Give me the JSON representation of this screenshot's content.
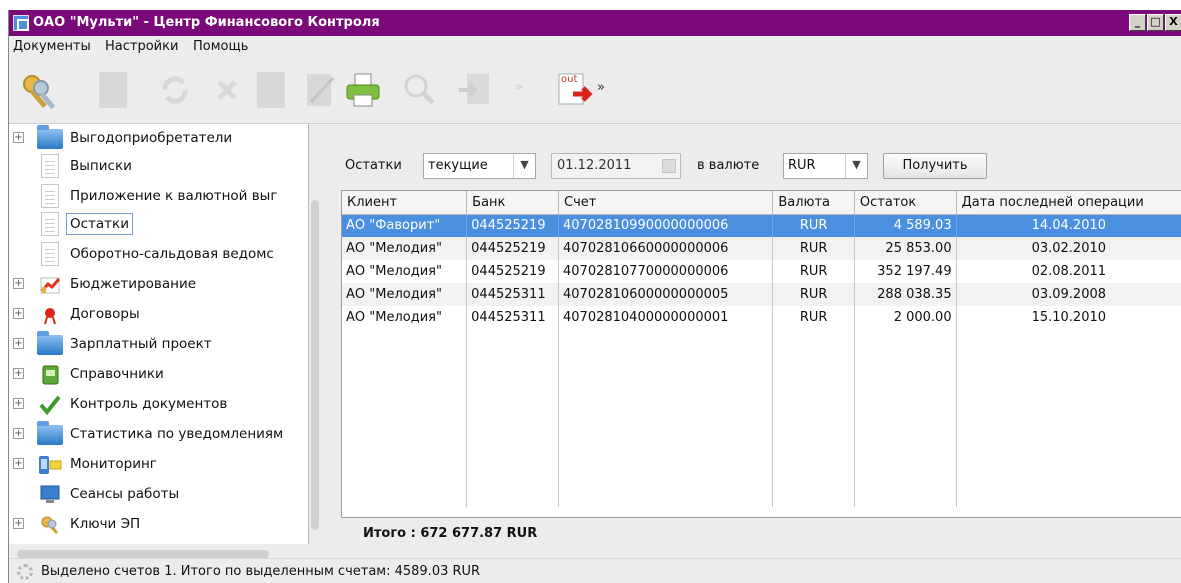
{
  "window": {
    "title": "ОАО \"Мульти\" - Центр Финансового Контроля",
    "controls": {
      "minimize": "_",
      "maximize": "□",
      "close": "X"
    }
  },
  "menu": [
    "Документы",
    "Настройки",
    "Помощь"
  ],
  "toolbar": {
    "icons": [
      "keys-icon",
      "document-icon",
      "refresh-icon",
      "delete-icon",
      "save-icon",
      "edit-icon",
      "print-icon",
      "search-icon",
      "import-icon",
      "more-chevron-icon",
      "export-out-icon",
      "more-chevron-icon"
    ],
    "export_label": "out"
  },
  "sidebar": {
    "items": [
      {
        "label": "Выгодоприобретатели",
        "icon": "folder-icon",
        "expandable": true
      },
      {
        "label": "Выписки",
        "icon": "page-icon",
        "expandable": false
      },
      {
        "label": "Приложение к валютной выг",
        "icon": "page-icon",
        "expandable": false
      },
      {
        "label": "Остатки",
        "icon": "page-icon",
        "expandable": false,
        "selected": true
      },
      {
        "label": "Оборотно-сальдовая ведомс",
        "icon": "page-icon",
        "expandable": false
      },
      {
        "label": "Бюджетирование",
        "icon": "chart-icon",
        "expandable": true
      },
      {
        "label": "Договоры",
        "icon": "ribbon-icon",
        "expandable": true
      },
      {
        "label": "Зарплатный проект",
        "icon": "folder-icon",
        "expandable": true
      },
      {
        "label": "Справочники",
        "icon": "book-icon",
        "expandable": true
      },
      {
        "label": "Контроль документов",
        "icon": "checkmark-icon",
        "expandable": true
      },
      {
        "label": "Статистика по уведомлениям",
        "icon": "folder-icon",
        "expandable": true
      },
      {
        "label": "Мониторинг",
        "icon": "phone-mail-icon",
        "expandable": true
      },
      {
        "label": "Сеансы работы",
        "icon": "monitor-icon",
        "expandable": false
      },
      {
        "label": "Ключи ЭП",
        "icon": "keys-icon",
        "expandable": true
      }
    ]
  },
  "filter": {
    "label_balances": "Остатки",
    "balance_type": "текущие",
    "date": "01.12.2011",
    "label_currency": "в валюте",
    "currency": "RUR",
    "get_button": "Получить"
  },
  "table": {
    "columns": [
      "Клиент",
      "Банк",
      "Счет",
      "Валюта",
      "Остаток",
      "Дата последней операции"
    ],
    "rows": [
      [
        "АО \"Фаворит\"",
        "044525219",
        "40702810990000000006",
        "RUR",
        "4 589.03",
        "14.04.2010"
      ],
      [
        "АО \"Мелодия\"",
        "044525219",
        "40702810660000000006",
        "RUR",
        "25 853.00",
        "03.02.2010"
      ],
      [
        "АО \"Мелодия\"",
        "044525219",
        "40702810770000000006",
        "RUR",
        "352 197.49",
        "02.08.2011"
      ],
      [
        "АО \"Мелодия\"",
        "044525311",
        "40702810600000000005",
        "RUR",
        "288 038.35",
        "03.09.2008"
      ],
      [
        "АО \"Мелодия\"",
        "044525311",
        "40702810400000000001",
        "RUR",
        "2 000.00",
        "15.10.2010"
      ]
    ],
    "selected_row": 0
  },
  "total": "Итого :   672 677.87 RUR",
  "status": "Выделено счетов 1. Итого по выделенным счетам: 4589.03 RUR",
  "colors": {
    "titlebar": "#7a0a7a",
    "selection": "#4b8fe0"
  }
}
